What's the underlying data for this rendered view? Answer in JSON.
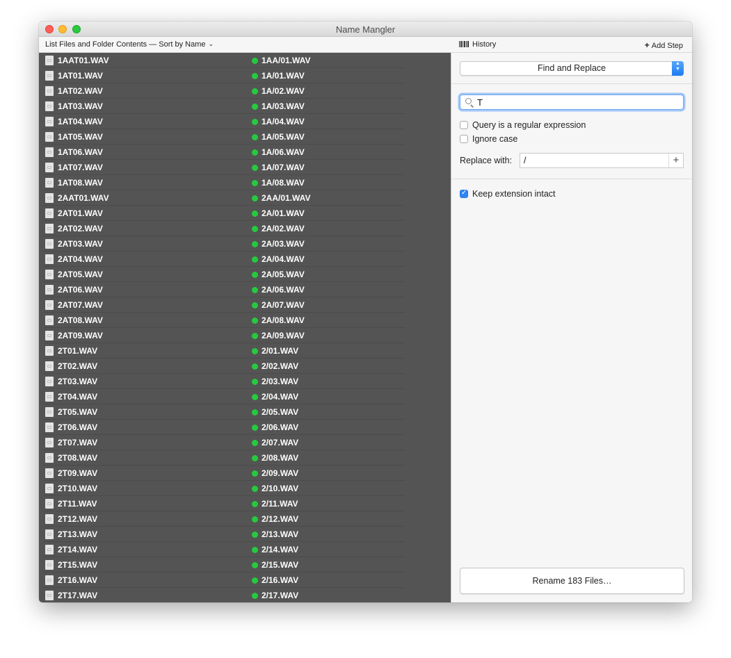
{
  "window": {
    "title": "Name Mangler"
  },
  "toolbar": {
    "sort_label": "List Files and Folder Contents — Sort by Name",
    "history_label": "History",
    "add_step_label": "Add Step"
  },
  "files": [
    {
      "original": "1AAT01.WAV",
      "renamed": "1AA/01.WAV"
    },
    {
      "original": "1AT01.WAV",
      "renamed": "1A/01.WAV"
    },
    {
      "original": "1AT02.WAV",
      "renamed": "1A/02.WAV"
    },
    {
      "original": "1AT03.WAV",
      "renamed": "1A/03.WAV"
    },
    {
      "original": "1AT04.WAV",
      "renamed": "1A/04.WAV"
    },
    {
      "original": "1AT05.WAV",
      "renamed": "1A/05.WAV"
    },
    {
      "original": "1AT06.WAV",
      "renamed": "1A/06.WAV"
    },
    {
      "original": "1AT07.WAV",
      "renamed": "1A/07.WAV"
    },
    {
      "original": "1AT08.WAV",
      "renamed": "1A/08.WAV"
    },
    {
      "original": "2AAT01.WAV",
      "renamed": "2AA/01.WAV"
    },
    {
      "original": "2AT01.WAV",
      "renamed": "2A/01.WAV"
    },
    {
      "original": "2AT02.WAV",
      "renamed": "2A/02.WAV"
    },
    {
      "original": "2AT03.WAV",
      "renamed": "2A/03.WAV"
    },
    {
      "original": "2AT04.WAV",
      "renamed": "2A/04.WAV"
    },
    {
      "original": "2AT05.WAV",
      "renamed": "2A/05.WAV"
    },
    {
      "original": "2AT06.WAV",
      "renamed": "2A/06.WAV"
    },
    {
      "original": "2AT07.WAV",
      "renamed": "2A/07.WAV"
    },
    {
      "original": "2AT08.WAV",
      "renamed": "2A/08.WAV"
    },
    {
      "original": "2AT09.WAV",
      "renamed": "2A/09.WAV"
    },
    {
      "original": "2T01.WAV",
      "renamed": "2/01.WAV"
    },
    {
      "original": "2T02.WAV",
      "renamed": "2/02.WAV"
    },
    {
      "original": "2T03.WAV",
      "renamed": "2/03.WAV"
    },
    {
      "original": "2T04.WAV",
      "renamed": "2/04.WAV"
    },
    {
      "original": "2T05.WAV",
      "renamed": "2/05.WAV"
    },
    {
      "original": "2T06.WAV",
      "renamed": "2/06.WAV"
    },
    {
      "original": "2T07.WAV",
      "renamed": "2/07.WAV"
    },
    {
      "original": "2T08.WAV",
      "renamed": "2/08.WAV"
    },
    {
      "original": "2T09.WAV",
      "renamed": "2/09.WAV"
    },
    {
      "original": "2T10.WAV",
      "renamed": "2/10.WAV"
    },
    {
      "original": "2T11.WAV",
      "renamed": "2/11.WAV"
    },
    {
      "original": "2T12.WAV",
      "renamed": "2/12.WAV"
    },
    {
      "original": "2T13.WAV",
      "renamed": "2/13.WAV"
    },
    {
      "original": "2T14.WAV",
      "renamed": "2/14.WAV"
    },
    {
      "original": "2T15.WAV",
      "renamed": "2/15.WAV"
    },
    {
      "original": "2T16.WAV",
      "renamed": "2/16.WAV"
    },
    {
      "original": "2T17.WAV",
      "renamed": "2/17.WAV"
    }
  ],
  "step": {
    "selected": "Find and Replace",
    "find_value": "T",
    "regex_label": "Query is a regular expression",
    "regex_checked": false,
    "ignore_case_label": "Ignore case",
    "ignore_case_checked": false,
    "replace_label": "Replace with:",
    "replace_value": "/",
    "keep_extension_label": "Keep extension intact",
    "keep_extension_checked": true
  },
  "rename_button_label": "Rename 183 Files…",
  "colors": {
    "status_ok": "#27c93f",
    "accent": "#2f86f4",
    "file_pane_bg": "#545454"
  },
  "icons": {
    "file": "document-icon",
    "status": "green-dot-icon",
    "history": "barcode-icon",
    "add": "plus-icon",
    "search": "search-icon"
  }
}
